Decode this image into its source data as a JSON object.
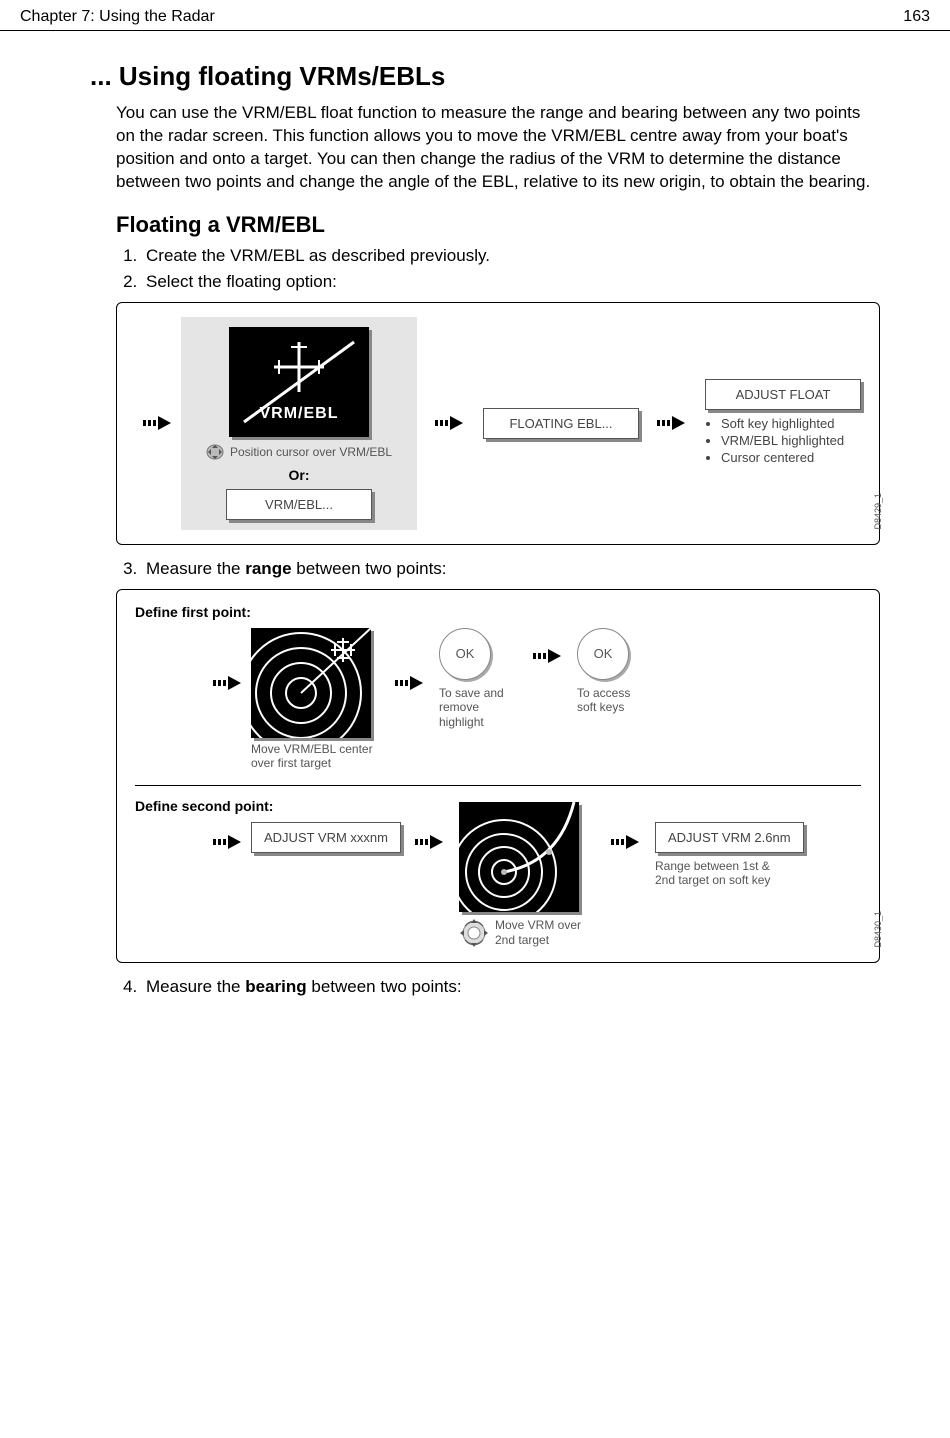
{
  "header": {
    "chapter": "Chapter 7: Using the Radar",
    "page": "163"
  },
  "section_title": "... Using floating VRMs/EBLs",
  "intro": "You can use the VRM/EBL float function to measure the range and bearing between any two points on the radar screen. This function allows you to move the VRM/EBL centre away from your boat's position and onto a target. You can then change the radius of the VRM to determine the distance between two points and change the angle of the EBL, relative to its new origin, to obtain the bearing.",
  "subheading": "Floating a VRM/EBL",
  "step1": "Create the VRM/EBL as described previously.",
  "step2": "Select the floating option:",
  "fig1": {
    "vrm_label": "VRM/EBL",
    "cursor_hint": "Position cursor over VRM/EBL",
    "or": "Or:",
    "vrmebl_key": "VRM/EBL...",
    "floating_key": "FLOATING EBL...",
    "adjust_key": "ADJUST FLOAT",
    "bullets": [
      "Soft key highlighted",
      "VRM/EBL highlighted",
      "Cursor centered"
    ],
    "id": "D8429_1"
  },
  "step3_pre": "Measure the ",
  "step3_strong": "range",
  "step3_post": " between two points:",
  "fig2": {
    "head1": "Define first point:",
    "move1": "Move VRM/EBL center over first target",
    "ok": "OK",
    "ok1_label": "To save and remove highlight",
    "ok2_label": "To access soft keys",
    "head2": "Define second point:",
    "adj1": "ADJUST VRM xxxnm",
    "move2": "Move VRM over 2nd target",
    "adj2": "ADJUST VRM 2.6nm",
    "range_label": "Range between 1st & 2nd target on soft key",
    "id": "D8430_1"
  },
  "step4_pre": "Measure the ",
  "step4_strong": "bearing",
  "step4_post": " between two points:"
}
